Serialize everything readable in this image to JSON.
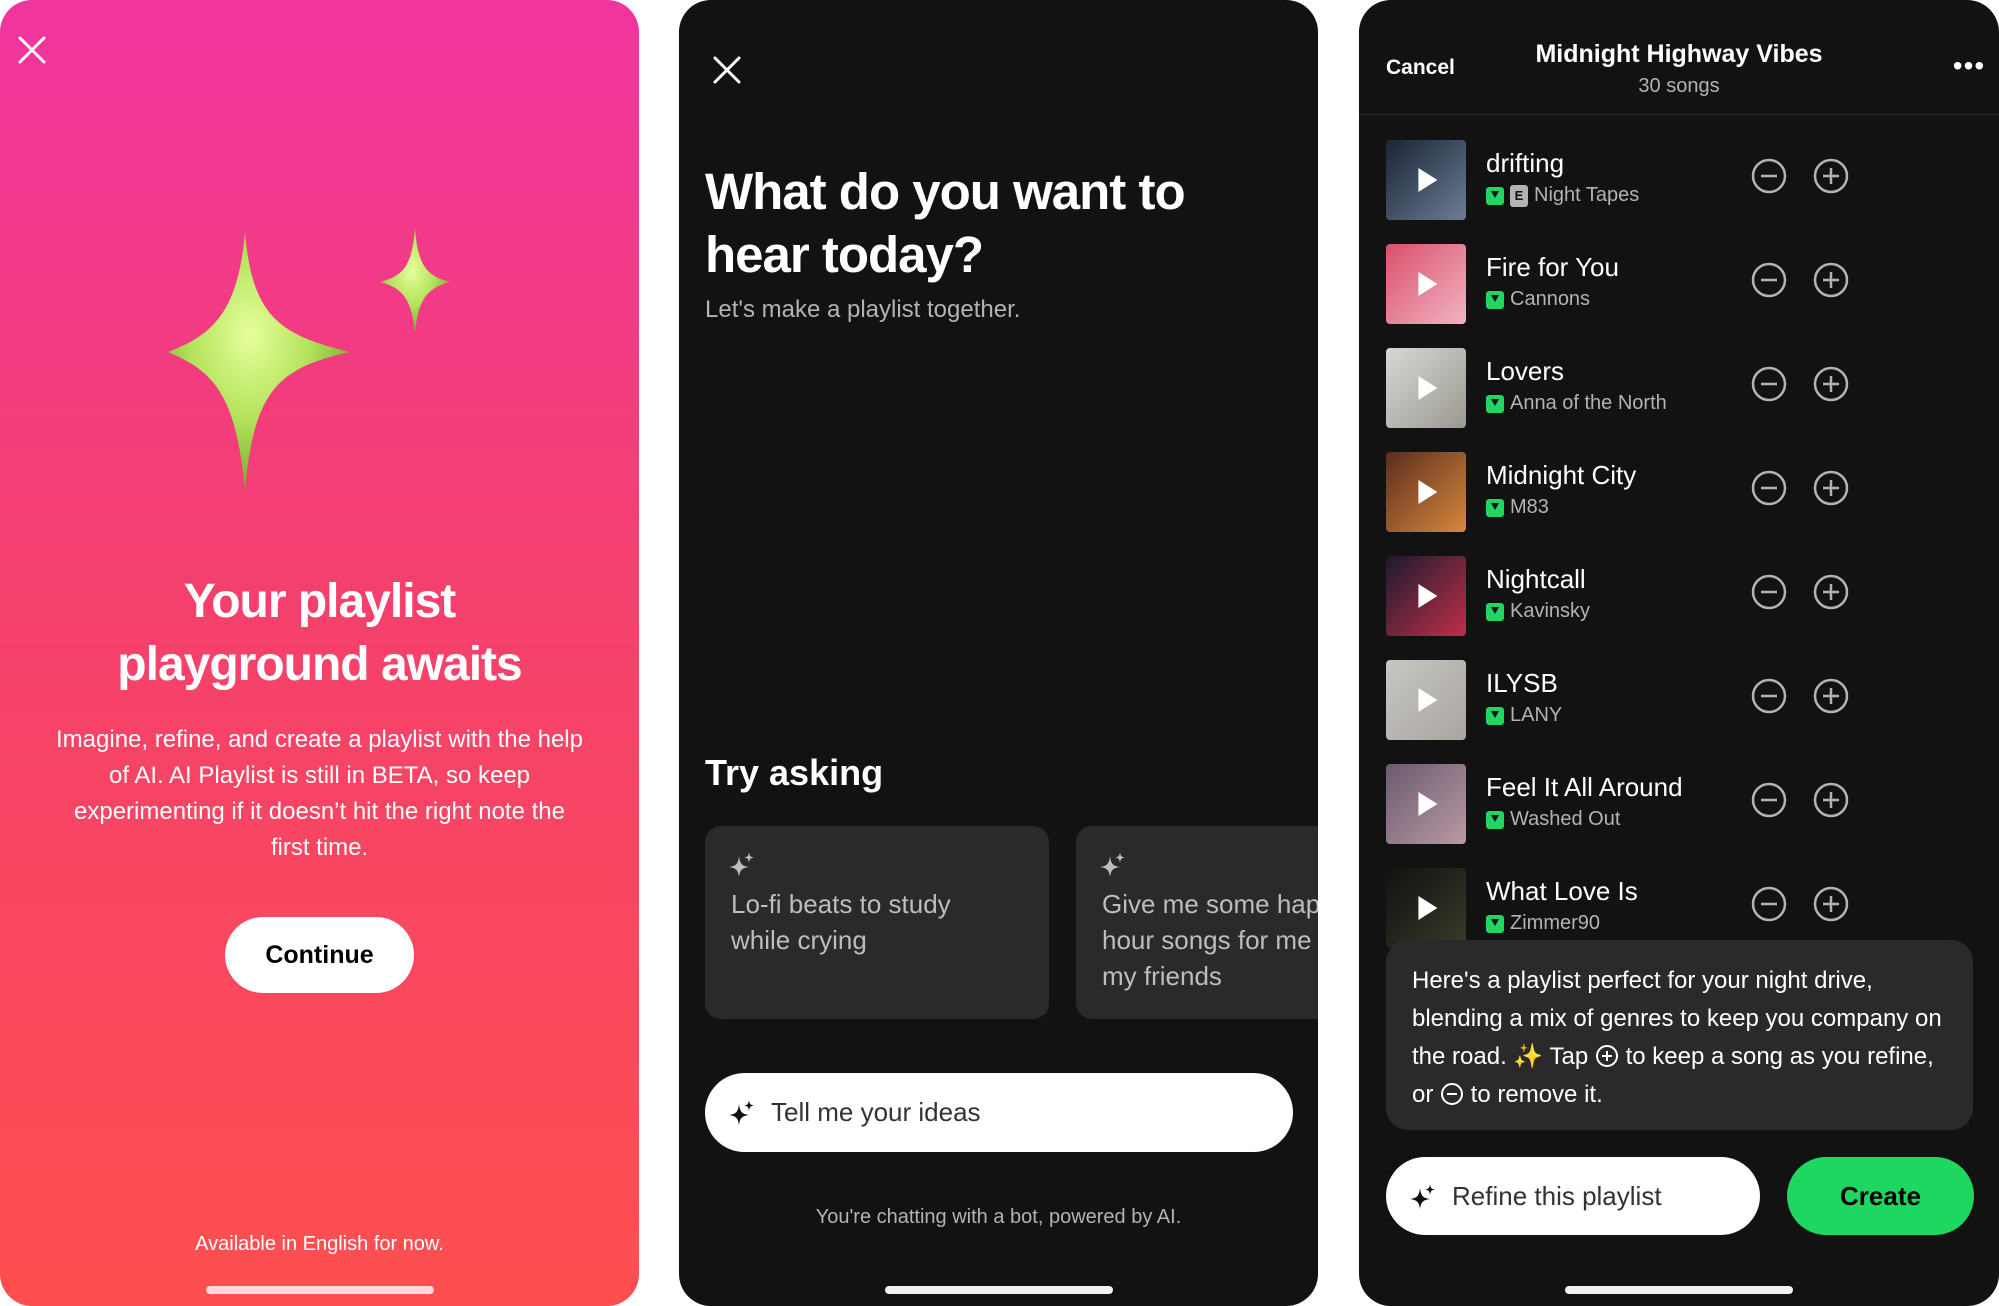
{
  "panel1": {
    "title_line1": "Your playlist",
    "title_line2": "playground awaits",
    "description": "Imagine, refine, and create a playlist with the help of AI. AI Playlist is still in BETA, so keep experimenting if it doesn’t hit the right note the first time.",
    "continue_label": "Continue",
    "footnote": "Available in English for now."
  },
  "panel2": {
    "heading": "What do you want to hear today?",
    "subheading": "Let's make a playlist together.",
    "try_asking": "Try asking",
    "suggestions": [
      {
        "line1": "Lo-fi beats to study",
        "line2": "while crying",
        "line3": ""
      },
      {
        "line1": "Give me some happy",
        "line2": "hour songs for me and",
        "line3": "my friends"
      }
    ],
    "input_placeholder": "Tell me your ideas",
    "bot_notice": "You're chatting with a bot, powered by AI."
  },
  "panel3": {
    "cancel_label": "Cancel",
    "playlist_title": "Midnight Highway Vibes",
    "song_count": "30 songs",
    "more_label": "•••",
    "songs": [
      {
        "title": "drifting",
        "artist": "Night Tapes",
        "explicit": true,
        "explicit_badge": "E",
        "art": [
          "#1a2535",
          "#6b7c94"
        ]
      },
      {
        "title": "Fire for You",
        "artist": "Cannons",
        "explicit": false,
        "art": [
          "#d9506b",
          "#f2b4c2"
        ]
      },
      {
        "title": "Lovers",
        "artist": "Anna of the North",
        "explicit": false,
        "art": [
          "#d8d8d4",
          "#9a9890"
        ]
      },
      {
        "title": "Midnight City",
        "artist": "M83",
        "explicit": false,
        "art": [
          "#5a2d1e",
          "#d7883c"
        ]
      },
      {
        "title": "Nightcall",
        "artist": "Kavinsky",
        "explicit": false,
        "art": [
          "#1a1a2e",
          "#c02f4a"
        ]
      },
      {
        "title": "ILYSB",
        "artist": "LANY",
        "explicit": false,
        "art": [
          "#c8c6c2",
          "#a9a6a1"
        ]
      },
      {
        "title": "Feel It All Around",
        "artist": "Washed Out",
        "explicit": false,
        "art": [
          "#6b5a6e",
          "#b89aa4"
        ]
      },
      {
        "title": "What Love Is",
        "artist": "Zimmer90",
        "explicit": false,
        "art": [
          "#111",
          "#3a3a2a"
        ]
      }
    ],
    "message": {
      "part1": "Here's a playlist perfect for your night drive, blending a mix of genres to keep you company on the road. ",
      "sparkle_emoji": "✨",
      "part2": " Tap ",
      "part3": " to keep a song as you refine, or ",
      "part4": " to remove it."
    },
    "refine_placeholder": "Refine this playlist",
    "create_label": "Create"
  },
  "colors": {
    "accent_green": "#1ed760",
    "gradient_top": "#f0359f",
    "gradient_bottom": "#fe4f4f",
    "star_color": "#b3e35a",
    "dark_bg": "#121212"
  }
}
